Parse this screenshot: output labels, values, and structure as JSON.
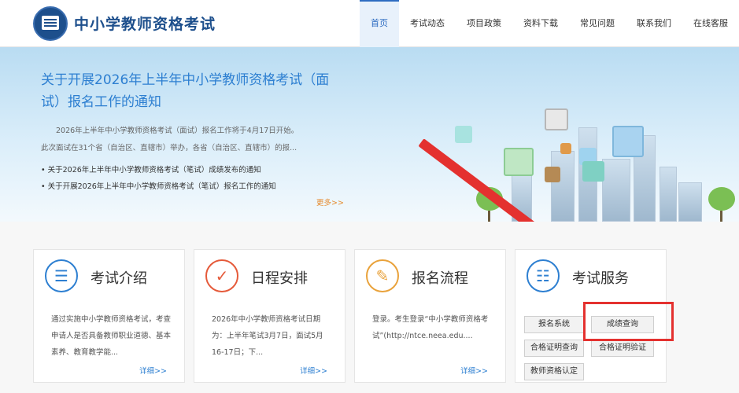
{
  "header": {
    "site_title": "中小学教师资格考试",
    "nav": [
      "首页",
      "考试动态",
      "项目政策",
      "资料下载",
      "常见问题",
      "联系我们",
      "在线客服"
    ]
  },
  "banner": {
    "title": "关于开展2026年上半年中小学教师资格考试（面试）报名工作的通知",
    "description": "2026年上半年中小学教师资格考试（面试）报名工作将于4月17日开始。此次面试在31个省（自治区、直辖市）举办，各省（自治区、直辖市）的报...",
    "links": [
      "关于2026年上半年中小学教师资格考试（笔试）成绩发布的通知",
      "关于开展2026年上半年中小学教师资格考试（笔试）报名工作的通知"
    ],
    "more": "更多>>"
  },
  "cards": [
    {
      "title": "考试介绍",
      "icon": "document-icon",
      "text": "通过实施中小学教师资格考试，考查申请人是否具备教师职业道德、基本素养、教育教学能...",
      "more": "详细>>"
    },
    {
      "title": "日程安排",
      "icon": "checkmark-icon",
      "text": "2026年中小学教师资格考试日期为：上半年笔试3月7日，面试5月16-17日；下...",
      "more": "详细>>"
    },
    {
      "title": "报名流程",
      "icon": "form-icon",
      "text": "登录。考生登录“中小学教师资格考试”(http://ntce.neea.edu....",
      "more": "详细>>"
    }
  ],
  "services": {
    "title": "考试服务",
    "icon": "contacts-icon",
    "buttons": [
      "报名系统",
      "成绩查询",
      "合格证明查询",
      "合格证明验证",
      "教师资格认定"
    ]
  }
}
